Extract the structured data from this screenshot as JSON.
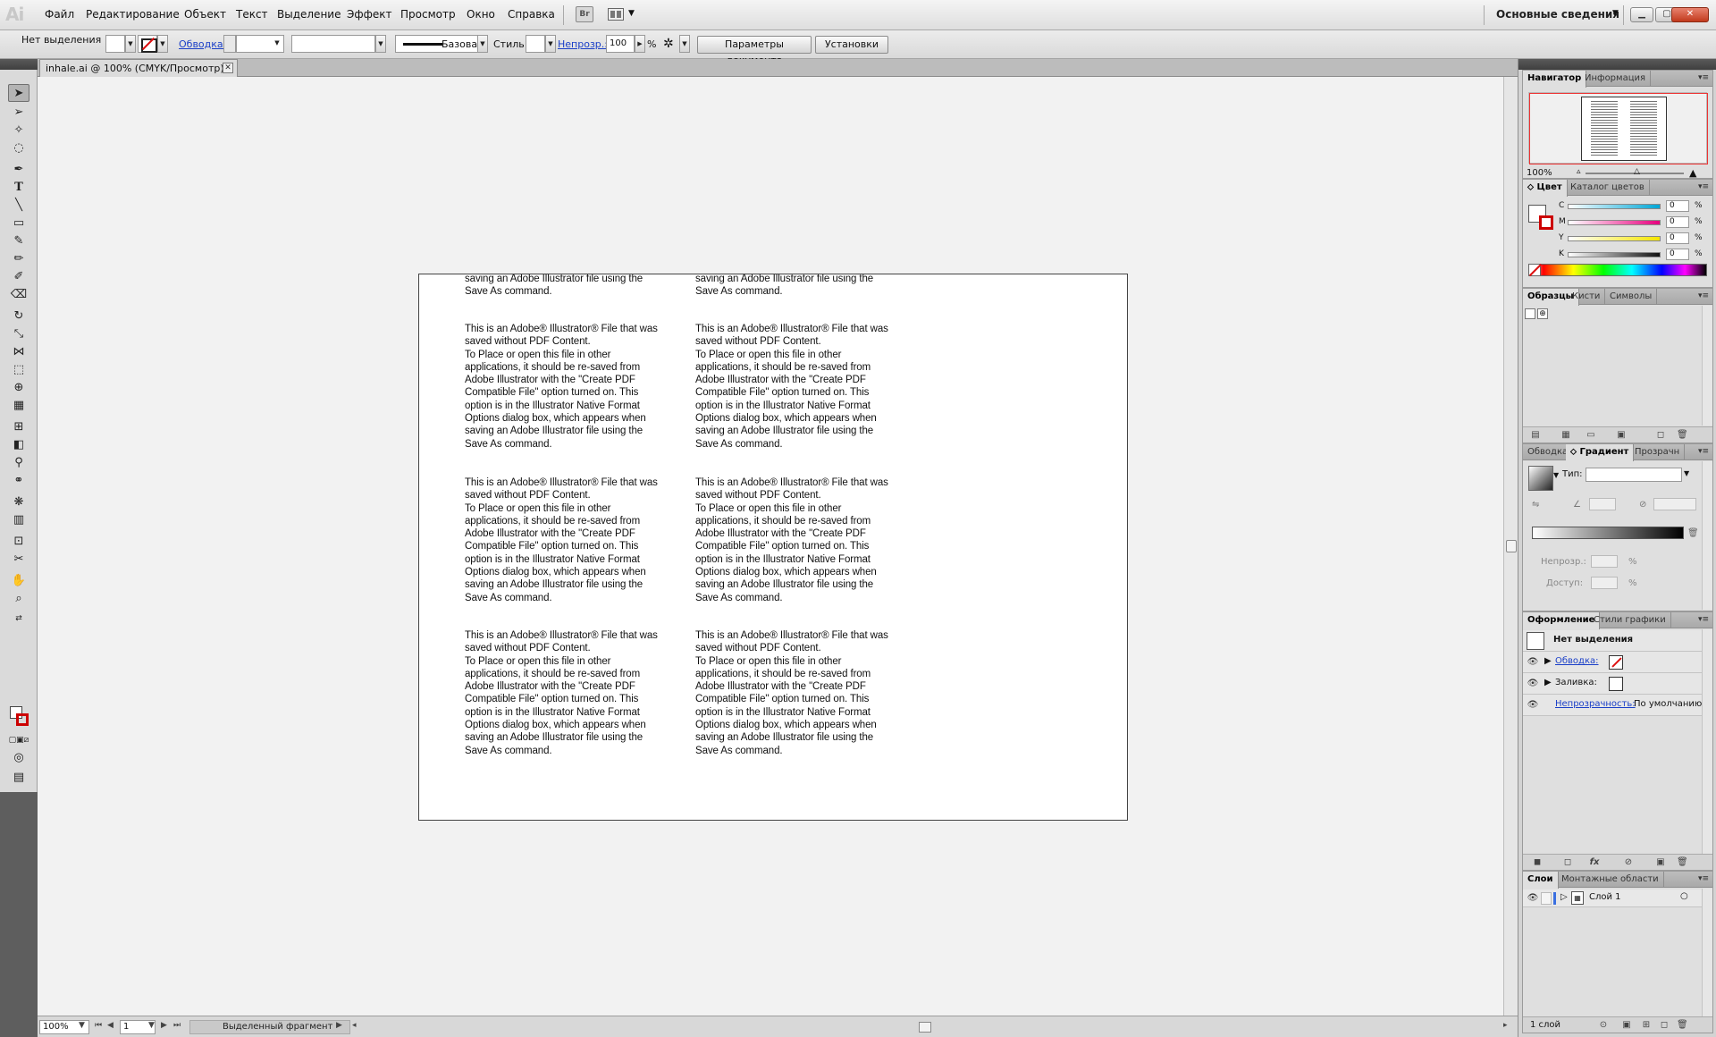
{
  "app": {
    "logo": "Ai",
    "menu": [
      "Файл",
      "Редактирование",
      "Объект",
      "Текст",
      "Выделение",
      "Эффект",
      "Просмотр",
      "Окно",
      "Справка"
    ],
    "bridge_label": "Br",
    "workspace": "Основные сведения"
  },
  "control_bar": {
    "selection_label": "Нет выделения",
    "stroke_label": "Обводка:",
    "stroke_line_label": "Базовая",
    "style_label": "Стиль:",
    "opacity_label": "Непрозр.:",
    "opacity_value": "100",
    "opacity_unit": "%",
    "doc_settings_button": "Параметры документа",
    "preferences_button": "Установки"
  },
  "document": {
    "tab_title": "inhale.ai @ 100% (CMYK/Просмотр)",
    "top_fragment": "saving an Adobe Illustrator file using the\nSave As command.",
    "body_text": "This is an Adobe® Illustrator® File that was\nsaved without PDF Content.\nTo Place or open this file in other\napplications, it should be re-saved from\nAdobe Illustrator with the \"Create PDF\nCompatible File\" option turned on. This\noption is in the Illustrator Native Format\nOptions dialog box, which appears when\nsaving an Adobe Illustrator file using the\nSave As command."
  },
  "status_bar": {
    "zoom": "100%",
    "page": "1",
    "status": "Выделенный фрагмент"
  },
  "panels": {
    "navigator": {
      "tabs": [
        "Навигатор",
        "Информация"
      ],
      "zoom": "100%"
    },
    "color": {
      "tabs": [
        "Цвет",
        "Каталог цветов"
      ],
      "channels": [
        {
          "label": "C",
          "value": "0",
          "color": "#00a6d6"
        },
        {
          "label": "M",
          "value": "0",
          "color": "#e6007e"
        },
        {
          "label": "Y",
          "value": "0",
          "color": "#f5e600"
        },
        {
          "label": "K",
          "value": "0",
          "color": "#111111"
        }
      ],
      "unit": "%"
    },
    "swatches": {
      "tabs": [
        "Образцы",
        "Кисти",
        "Символы"
      ]
    },
    "gradient": {
      "tabs": [
        "Обводка",
        "Градиент",
        "Прозрачн"
      ],
      "type_label": "Тип:",
      "opacity_label": "Непрозр.:",
      "location_label": "Доступ:",
      "unit": "%"
    },
    "appearance": {
      "tabs": [
        "Оформление",
        "Стили графики"
      ],
      "header": "Нет выделения",
      "stroke_label": "Обводка:",
      "fill_label": "Заливка:",
      "opacity_label": "Непрозрачность:",
      "opacity_value": "По умолчанию"
    },
    "layers": {
      "tabs": [
        "Слои",
        "Монтажные области"
      ],
      "layer_name": "Слой 1",
      "count": "1 слой"
    }
  },
  "colors": {
    "accent_red": "#d11a1a",
    "link_blue": "#1a3fc8"
  }
}
